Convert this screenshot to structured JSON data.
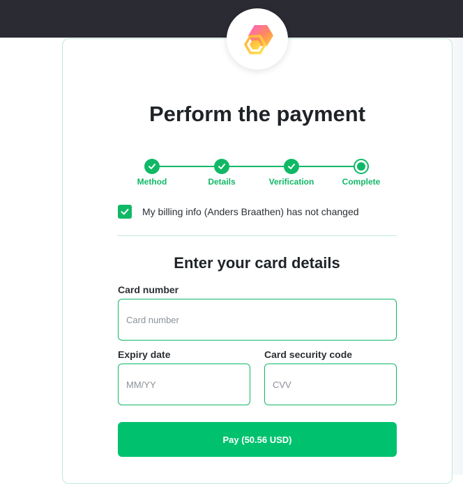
{
  "page": {
    "title": "Perform the payment",
    "logo_icon": "hex-logo-icon"
  },
  "colors": {
    "accent": "#10b866",
    "button": "#00c26e",
    "topbar": "#2a2b33",
    "border": "#bfe9d6"
  },
  "stepper": {
    "steps": [
      {
        "label": "Method",
        "state": "done"
      },
      {
        "label": "Details",
        "state": "done"
      },
      {
        "label": "Verification",
        "state": "done"
      },
      {
        "label": "Complete",
        "state": "current"
      }
    ]
  },
  "billing": {
    "checked": true,
    "text": "My billing info (Anders Braathen) has not changed"
  },
  "card_form": {
    "heading": "Enter your card details",
    "card_number": {
      "label": "Card number",
      "placeholder": "Card number",
      "value": ""
    },
    "expiry": {
      "label": "Expiry date",
      "placeholder": "MM/YY",
      "value": ""
    },
    "cvv": {
      "label": "Card security code",
      "placeholder": "CVV",
      "value": ""
    },
    "pay_label": "Pay (50.56 USD)"
  }
}
